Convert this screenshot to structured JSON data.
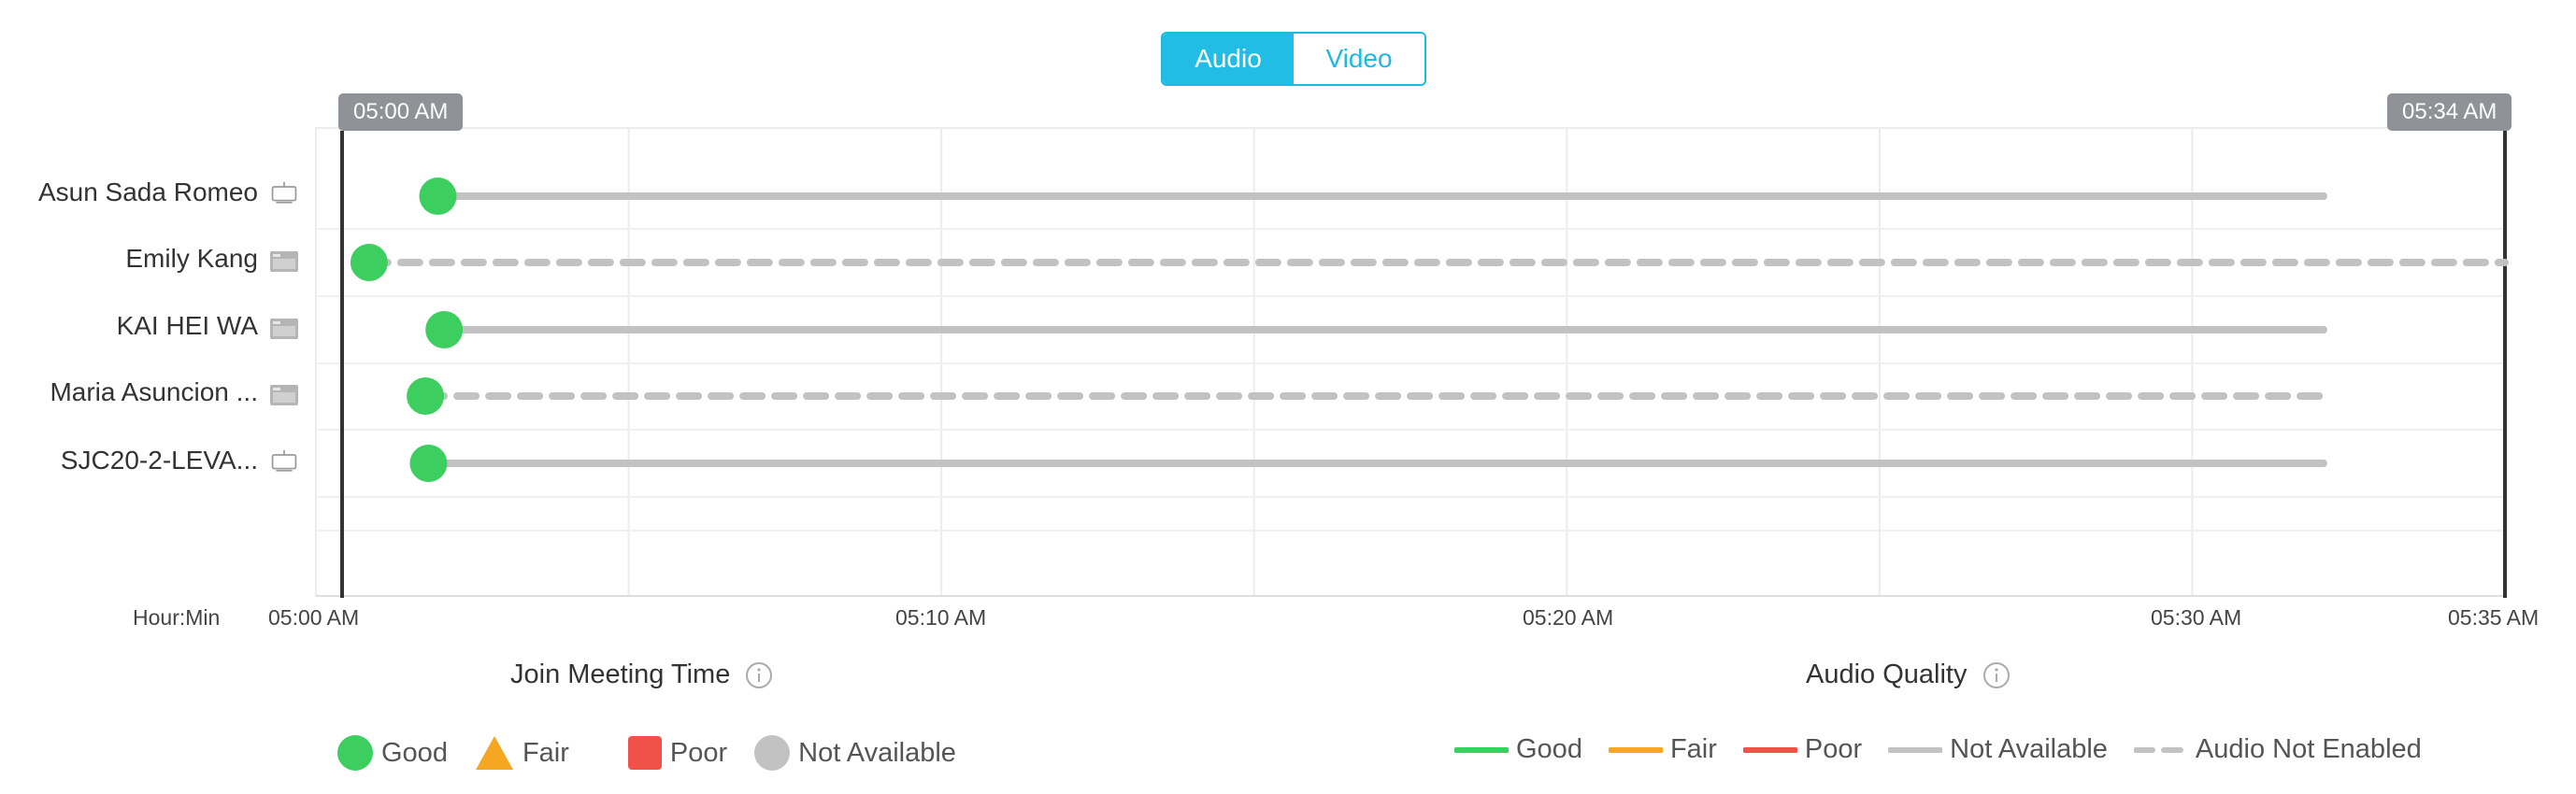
{
  "tabs": [
    {
      "label": "Audio",
      "active": true
    },
    {
      "label": "Video",
      "active": false
    }
  ],
  "range_badges": {
    "start": "05:00 AM",
    "end": "05:34 AM"
  },
  "axis": {
    "unit_label": "Hour:Min",
    "ticks": [
      "05:00 AM",
      "05:10 AM",
      "05:20 AM",
      "05:30 AM",
      "05:35 AM"
    ]
  },
  "participants": [
    {
      "name": "Asun Sada Romeo",
      "device": "tv-icon",
      "join_minute": 1.95,
      "end_minute": 32.1,
      "line": "solid"
    },
    {
      "name": "Emily Kang",
      "device": "desktop-app-icon",
      "join_minute": 0.85,
      "end_minute": 35.0,
      "line": "dashed"
    },
    {
      "name": "KAI HEI WA",
      "device": "desktop-app-icon",
      "join_minute": 2.05,
      "end_minute": 32.1,
      "line": "solid"
    },
    {
      "name": "Maria Asuncion ...",
      "device": "desktop-app-icon",
      "join_minute": 1.75,
      "end_minute": 32.1,
      "line": "dashed"
    },
    {
      "name": "SJC20-2-LEVA...",
      "device": "tv-icon",
      "join_minute": 1.8,
      "end_minute": 32.1,
      "line": "solid"
    }
  ],
  "sections": {
    "join": "Join Meeting Time",
    "quality": "Audio Quality"
  },
  "join_legend": {
    "good": "Good",
    "fair": "Fair",
    "poor": "Poor",
    "na": "Not Available"
  },
  "quality_legend": {
    "good": "Good",
    "fair": "Fair",
    "poor": "Poor",
    "na": "Not Available",
    "not_enabled": "Audio Not Enabled"
  },
  "colors": {
    "good": "#3ccf5f",
    "fair": "#f5a623",
    "poor": "#f0524a",
    "na": "#c2c2c2",
    "accent": "#22bde4",
    "badge": "#8f9296"
  }
}
